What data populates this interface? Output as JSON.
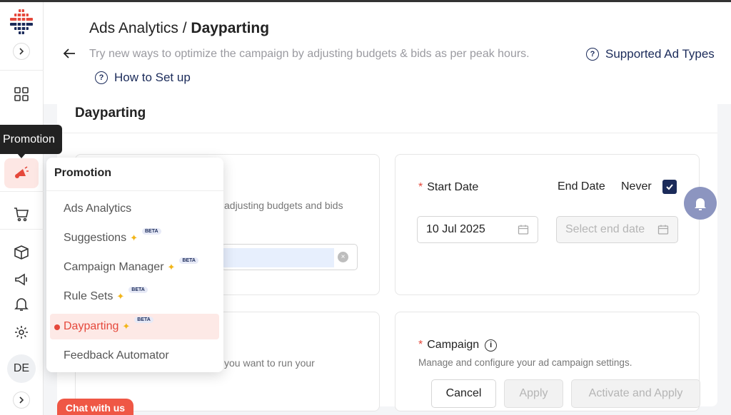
{
  "header": {
    "breadcrumb_parent": "Ads Analytics /",
    "breadcrumb_current": "Dayparting",
    "subtitle": "Try new ways to optimize the campaign by adjusting budgets & bids as per peak hours.",
    "how_to": "How to Set up",
    "supported": "Supported Ad Types"
  },
  "tooltip": "Promotion",
  "menu": {
    "title": "Promotion",
    "items": [
      {
        "label": "Ads Analytics",
        "beta": false,
        "active": false
      },
      {
        "label": "Suggestions",
        "beta": true,
        "active": false
      },
      {
        "label": "Campaign Manager",
        "beta": true,
        "active": false
      },
      {
        "label": "Rule Sets",
        "beta": true,
        "active": false
      },
      {
        "label": "Dayparting",
        "beta": true,
        "active": true
      },
      {
        "label": "Feedback Automator",
        "beta": false,
        "active": false
      }
    ],
    "beta_label": "BETA"
  },
  "card": {
    "title": "Dayparting",
    "partial_text_1": "adjusting budgets and bids",
    "partial_text_2": "you want to run your",
    "start_date_label": "Start Date",
    "start_date_value": "10 Jul 2025",
    "end_date_label": "End Date",
    "never_label": "Never",
    "never_checked": true,
    "end_date_placeholder": "Select end date",
    "campaign_label": "Campaign",
    "campaign_help": "Manage and configure your ad campaign settings."
  },
  "buttons": {
    "cancel": "Cancel",
    "apply": "Apply",
    "activate": "Activate and Apply"
  },
  "avatar": "DE",
  "chat": "Chat with us",
  "colors": {
    "accent": "#e5483b",
    "navy": "#1b2b5a",
    "bell_fab": "#8c95c0"
  }
}
